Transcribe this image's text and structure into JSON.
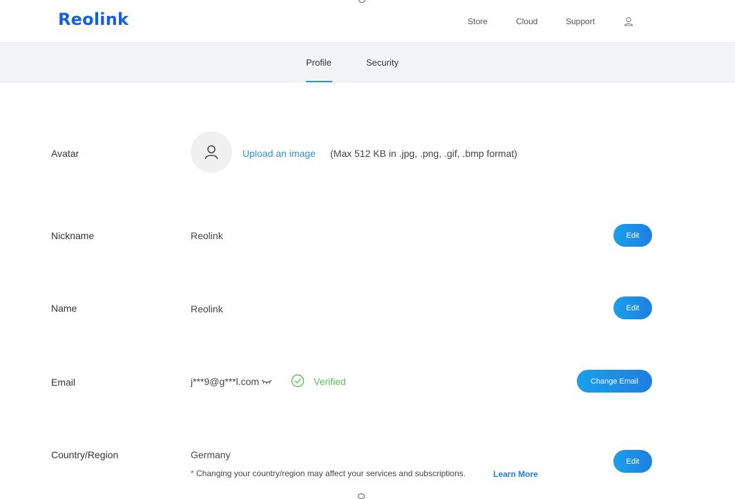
{
  "header": {
    "logo": "Reolink",
    "nav": [
      {
        "label": "Store"
      },
      {
        "label": "Cloud"
      },
      {
        "label": "Support"
      }
    ]
  },
  "subnav": {
    "tabs": [
      {
        "label": "Profile",
        "active": true
      },
      {
        "label": "Security",
        "active": false
      }
    ]
  },
  "profile": {
    "avatar": {
      "label": "Avatar",
      "upload_link": "Upload an image",
      "upload_hint": "(Max 512 KB in .jpg, .png, .gif, .bmp format)"
    },
    "nickname": {
      "label": "Nickname",
      "value": "Reolink",
      "button": "Edit"
    },
    "name": {
      "label": "Name",
      "value": "Reolink",
      "button": "Edit"
    },
    "email": {
      "label": "Email",
      "value": "j***9@g***l.com",
      "status": "Verified",
      "button": "Change Email"
    },
    "country": {
      "label": "Country/Region",
      "value": "Germany",
      "note_star": "*",
      "note": "Changing your country/region may affect your services and subscriptions.",
      "learn_more": "Learn More",
      "button": "Edit"
    }
  },
  "colors": {
    "brand": "#1262e0",
    "accent": "#1a96e8",
    "verified": "#58c25a"
  }
}
